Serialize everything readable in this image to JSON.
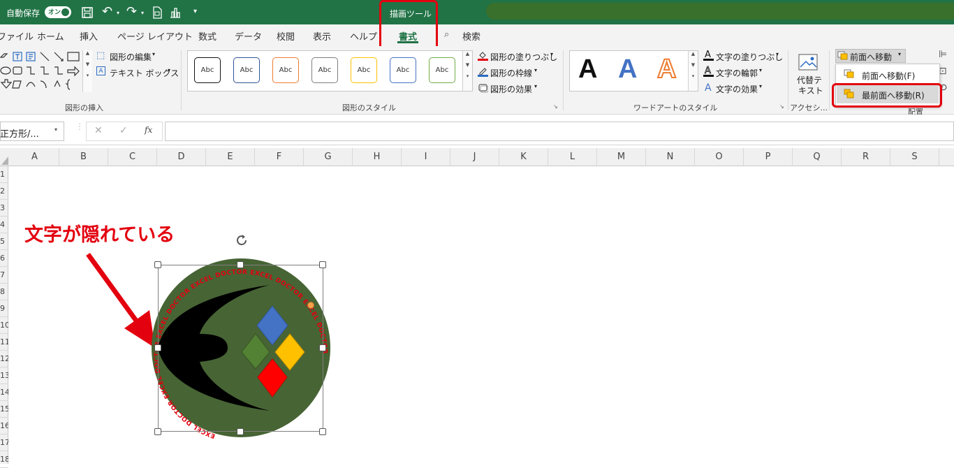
{
  "titlebar": {
    "autosave_label": "自動保存",
    "autosave_toggle": "オン",
    "context_tab": "描画ツール"
  },
  "tabs": [
    "ファイル",
    "ホーム",
    "挿入",
    "ページ レイアウト",
    "数式",
    "データ",
    "校閲",
    "表示",
    "ヘルプ",
    "書式"
  ],
  "search_label": "検索",
  "ribbon": {
    "insert_shapes": {
      "edit_shape": "図形の編集",
      "text_box": "テキスト ボックス",
      "label": "図形の挿入"
    },
    "shape_styles": {
      "sample": "Abc",
      "fill": "図形の塗りつぶし",
      "outline": "図形の枠線",
      "effects": "図形の効果",
      "label": "図形のスタイル"
    },
    "wordart": {
      "letter": "A",
      "text_fill": "文字の塗りつぶし",
      "text_outline": "文字の輪郭",
      "text_effects": "文字の効果",
      "label": "ワードアートのスタイル"
    },
    "accessibility": {
      "alt_text_1": "代替テ",
      "alt_text_2": "キスト",
      "label": "アクセシ..."
    },
    "arrange": {
      "bring_forward": "前面へ移動",
      "label": "配置"
    }
  },
  "dropdown": {
    "bring_forward": "前面へ移動(F)",
    "bring_to_front": "最前面へ移動(R)"
  },
  "formula_bar": {
    "name_box": "正方形/...",
    "fx": "fx",
    "value": ""
  },
  "columns": [
    "A",
    "B",
    "C",
    "D",
    "E",
    "F",
    "G",
    "H",
    "I",
    "J",
    "K",
    "L",
    "M",
    "N",
    "O",
    "P",
    "Q",
    "R",
    "S"
  ],
  "rows": [
    "1",
    "2",
    "3",
    "4",
    "5",
    "6",
    "7",
    "8",
    "9",
    "10",
    "11",
    "12",
    "13",
    "14",
    "15",
    "16",
    "17",
    "18"
  ],
  "annotation": "文字が隠れている",
  "colors": {
    "excel_green": "#217346",
    "annotation_red": "#e3000f",
    "logo_green": "#476434"
  }
}
